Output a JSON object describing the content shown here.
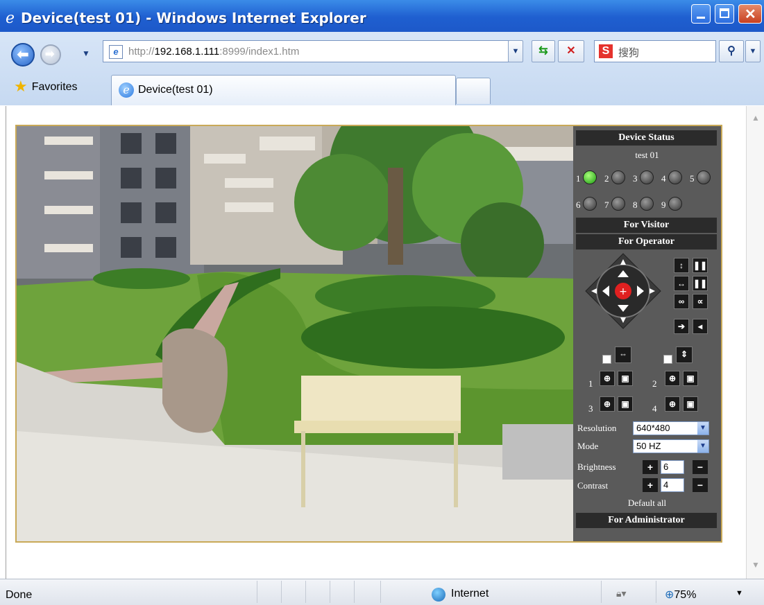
{
  "window": {
    "title": "Device(test 01) - Windows Internet Explorer"
  },
  "toolbar": {
    "url_prefix": "http://",
    "url_host": "192.168.1.111",
    "url_rest": ":8999/index1.htm",
    "search_placeholder": "搜狗"
  },
  "favorites": {
    "label": "Favorites"
  },
  "tab": {
    "title": "Device(test 01)"
  },
  "panel": {
    "device_status_header": "Device Status",
    "device_name": "test 01",
    "channels": [
      {
        "num": "1",
        "active": true
      },
      {
        "num": "2",
        "active": false
      },
      {
        "num": "3",
        "active": false
      },
      {
        "num": "4",
        "active": false
      },
      {
        "num": "5",
        "active": false
      },
      {
        "num": "6",
        "active": false
      },
      {
        "num": "7",
        "active": false
      },
      {
        "num": "8",
        "active": false
      },
      {
        "num": "9",
        "active": false
      }
    ],
    "visitor_header": "For Visitor",
    "operator_header": "For Operator",
    "preset_labels": [
      "1",
      "2",
      "3",
      "4"
    ],
    "resolution_label": "Resolution",
    "resolution_value": "640*480",
    "mode_label": "Mode",
    "mode_value": "50 HZ",
    "brightness_label": "Brightness",
    "brightness_value": "6",
    "contrast_label": "Contrast",
    "contrast_value": "4",
    "default_all": "Default all",
    "admin_header": "For Administrator"
  },
  "statusbar": {
    "status_text": "Done",
    "zone_text": "Internet",
    "zoom_text": "75%"
  },
  "colors": {
    "titlebar": "#1f5fd0",
    "panel_bg": "#5a5a5a",
    "header_bg": "#2b2b2b",
    "frame_border": "#c9a957",
    "led_on": "#1a9a10"
  }
}
